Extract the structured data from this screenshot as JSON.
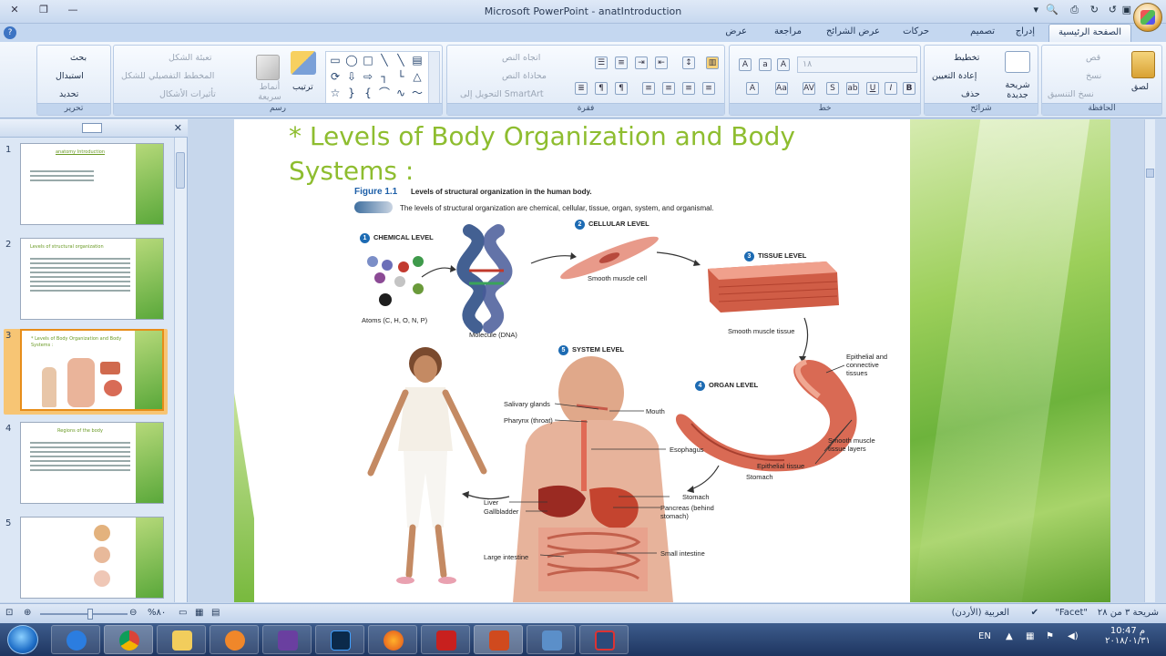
{
  "window": {
    "title": "Microsoft PowerPoint - anatIntroduction"
  },
  "ribbon_tabs": [
    {
      "label": "الصفحة الرئيسية",
      "active": true
    },
    {
      "label": "إدراج"
    },
    {
      "label": "تصميم"
    },
    {
      "label": "حركات"
    },
    {
      "label": "عرض الشرائح"
    },
    {
      "label": "مراجعة"
    },
    {
      "label": "عرض"
    }
  ],
  "groups": {
    "clipboard": {
      "label": "الحافظة",
      "paste": "لصق",
      "cut": "قص",
      "copy": "نسخ",
      "format_painter": "نسخ التنسيق"
    },
    "slides": {
      "label": "شرائح",
      "new_slide": "شريحة جديدة",
      "layout": "تخطيط",
      "reset": "إعادة التعيين",
      "delete": "حذف"
    },
    "font": {
      "label": "خط",
      "size": "١٨"
    },
    "paragraph": {
      "label": "فقرة",
      "text_direction": "اتجاه النص",
      "align_text": "محاذاة النص",
      "convert_smartart": "التحويل إلى SmartArt"
    },
    "drawing": {
      "label": "رسم",
      "arrange": "ترتيب",
      "quick_styles": "أنماط سريعة",
      "shape_fill": "تعبئة الشكل",
      "shape_outline": "المخطط التفصيلي للشكل",
      "shape_effects": "تأثيرات الأشكال"
    },
    "editing": {
      "label": "تحرير",
      "find": "بحث",
      "replace": "استبدال",
      "select": "تحديد"
    }
  },
  "slides_panel": {
    "thumbnails": [
      {
        "number": "1",
        "title": "anatomy   Introduction"
      },
      {
        "number": "2",
        "title": "Levels of structural organization"
      },
      {
        "number": "3",
        "title": "* Levels of Body Organization and Body Systems :",
        "active": true
      },
      {
        "number": "4",
        "title": "Regions of the body"
      },
      {
        "number": "5",
        "title": ""
      }
    ]
  },
  "slide": {
    "title_line1": "* Levels of Body Organization and Body",
    "title_line2": "Systems :",
    "figure": {
      "caption_label": "Figure 1.1",
      "caption_title": "Levels of structural organization in the human body.",
      "subtitle": "The levels of structural organization are chemical, cellular, tissue, organ, system, and organismal.",
      "levels": {
        "l1": {
          "num": "1",
          "label": "CHEMICAL LEVEL"
        },
        "l2": {
          "num": "2",
          "label": "CELLULAR LEVEL"
        },
        "l3": {
          "num": "3",
          "label": "TISSUE LEVEL"
        },
        "l4": {
          "num": "4",
          "label": "ORGAN LEVEL"
        },
        "l5": {
          "num": "5",
          "label": "SYSTEM LEVEL"
        }
      },
      "labels": {
        "atoms": "Atoms (C, H, O, N, P)",
        "molecule": "Molecule (DNA)",
        "cell": "Smooth muscle cell",
        "tissue": "Smooth muscle tissue",
        "epithelial": "Epithelial and connective tissues",
        "smooth_layers": "Smooth muscle tissue layers",
        "epithelial_tissue": "Epithelial tissue",
        "stomach_organ": "Stomach",
        "salivary": "Salivary glands",
        "pharynx": "Pharynx (throat)",
        "mouth": "Mouth",
        "esophagus": "Esophagus",
        "stomach": "Stomach",
        "liver": "Liver",
        "gallbladder": "Gallbladder",
        "pancreas": "Pancreas (behind stomach)",
        "small_int": "Small intestine",
        "large_int": "Large intestine"
      }
    }
  },
  "statusbar": {
    "slide_info": "شريحة ٣ من ٢٨",
    "theme": "\"Facet\"",
    "language": "العربية (الأردن)",
    "zoom": "%٨٠"
  },
  "taskbar": {
    "lang": "EN",
    "time": "10:47 م",
    "date": "٢٠١٨/٠١/٣١"
  }
}
